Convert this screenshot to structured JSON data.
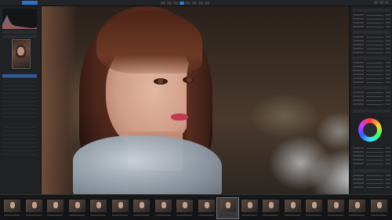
{
  "app": {
    "brand": "",
    "active_tab": ""
  },
  "toolbar": {
    "icons": [
      "crop-icon",
      "rotate-icon",
      "hand-icon",
      "zoom-icon",
      "brush-icon",
      "compare-icon",
      "grid-icon",
      "settings-icon"
    ]
  },
  "left_panel": {
    "histogram_header": "",
    "navigator_header": "",
    "list_rows_visible": 20,
    "selected_row_index": 1
  },
  "right_panel": {
    "adjustment_rows_visible": 36
  },
  "filmstrip": {
    "label": "",
    "count": 18,
    "selected_index": 10
  },
  "colors": {
    "accent": "#2c72c7",
    "selection": "#2d5f9e",
    "panel": "#202124",
    "lips": "#c23a50"
  }
}
